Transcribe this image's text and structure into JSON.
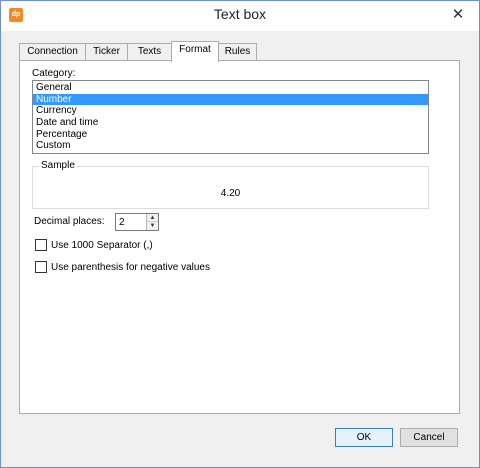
{
  "window": {
    "title": "Text box",
    "app_icon_text": "dp",
    "close_glyph": "✕"
  },
  "tabs": [
    {
      "label": "Connection",
      "active": false
    },
    {
      "label": "Ticker",
      "active": false
    },
    {
      "label": "Texts",
      "active": false
    },
    {
      "label": "Format",
      "active": true
    },
    {
      "label": "Rules",
      "active": false
    }
  ],
  "format": {
    "category_label": "Category:",
    "categories": [
      "General",
      "Number",
      "Currency",
      "Date and time",
      "Percentage",
      "Custom"
    ],
    "selected_category": "Number",
    "sample_title": "Sample",
    "sample_value": "4.20",
    "decimal_places_label": "Decimal places:",
    "decimal_places_value": "2",
    "use_separator_label": "Use 1000 Separator (,)",
    "use_separator_checked": false,
    "negative_parens_label": "Use parenthesis for negative values",
    "negative_parens_checked": false
  },
  "buttons": {
    "ok": "OK",
    "cancel": "Cancel"
  },
  "icons": {
    "spin_up": "▲",
    "spin_down": "▼"
  }
}
